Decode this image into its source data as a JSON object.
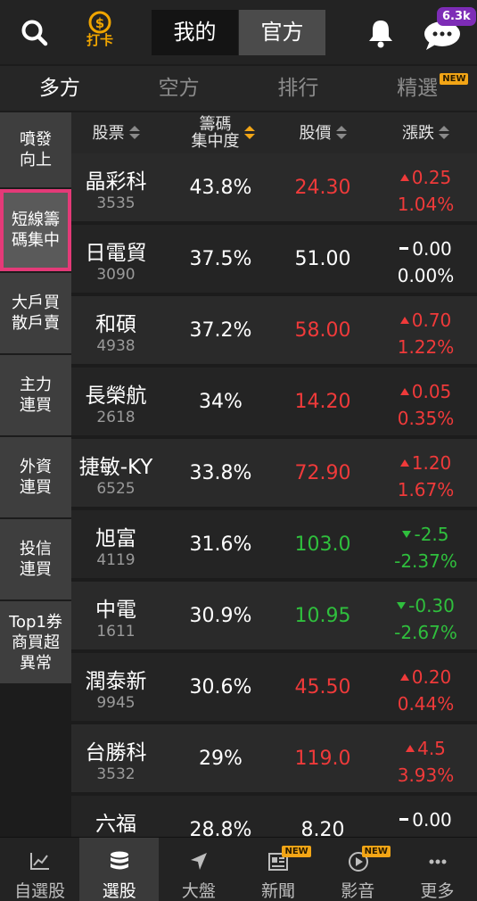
{
  "topbar": {
    "search_icon": "search-icon",
    "punch_label": "打卡",
    "segments": [
      "我的",
      "官方"
    ],
    "active_segment": "官方",
    "bell_icon": "bell-icon",
    "chat_icon": "chat-icon",
    "chat_badge": "6.3k"
  },
  "tabs": [
    {
      "label": "多方",
      "active": true
    },
    {
      "label": "空方"
    },
    {
      "label": "排行"
    },
    {
      "label": "精選",
      "badge": "NEW"
    }
  ],
  "sidebar": [
    {
      "label": "噴發\n向上"
    },
    {
      "label": "短線籌\n碼集中",
      "active": true
    },
    {
      "label": "大戶買\n散戶賣"
    },
    {
      "label": "主力\n連買"
    },
    {
      "label": "外資\n連買"
    },
    {
      "label": "投信\n連買"
    },
    {
      "label": "Top1券\n商買超\n異常"
    }
  ],
  "table": {
    "headers": {
      "stock": "股票",
      "concentration": "籌碼\n集中度",
      "price": "股價",
      "change": "漲跌"
    },
    "rows": [
      {
        "name": "晶彩科",
        "code": "3535",
        "concentration": "43.8%",
        "price": "24.30",
        "change": "0.25",
        "pct": "1.04%",
        "dir": "up"
      },
      {
        "name": "日電貿",
        "code": "3090",
        "concentration": "37.5%",
        "price": "51.00",
        "change": "0.00",
        "pct": "0.00%",
        "dir": "flat"
      },
      {
        "name": "和碩",
        "code": "4938",
        "concentration": "37.2%",
        "price": "58.00",
        "change": "0.70",
        "pct": "1.22%",
        "dir": "up"
      },
      {
        "name": "長榮航",
        "code": "2618",
        "concentration": "34%",
        "price": "14.20",
        "change": "0.05",
        "pct": "0.35%",
        "dir": "up"
      },
      {
        "name": "捷敏-KY",
        "code": "6525",
        "concentration": "33.8%",
        "price": "72.90",
        "change": "1.20",
        "pct": "1.67%",
        "dir": "up"
      },
      {
        "name": "旭富",
        "code": "4119",
        "concentration": "31.6%",
        "price": "103.0",
        "change": "-2.5",
        "pct": "-2.37%",
        "dir": "down"
      },
      {
        "name": "中電",
        "code": "1611",
        "concentration": "30.9%",
        "price": "10.95",
        "change": "-0.30",
        "pct": "-2.67%",
        "dir": "down"
      },
      {
        "name": "潤泰新",
        "code": "9945",
        "concentration": "30.6%",
        "price": "45.50",
        "change": "0.20",
        "pct": "0.44%",
        "dir": "up"
      },
      {
        "name": "台勝科",
        "code": "3532",
        "concentration": "29%",
        "price": "119.0",
        "change": "4.5",
        "pct": "3.93%",
        "dir": "up"
      },
      {
        "name": "六福",
        "code": "",
        "concentration": "28.8%",
        "price": "8.20",
        "change": "0.00",
        "pct": "",
        "dir": "flat"
      }
    ]
  },
  "bottomnav": [
    {
      "label": "自選股",
      "icon": "chart-line-icon"
    },
    {
      "label": "選股",
      "icon": "database-icon",
      "active": true
    },
    {
      "label": "大盤",
      "icon": "navigation-arrow-icon"
    },
    {
      "label": "新聞",
      "icon": "newspaper-icon",
      "badge": "NEW"
    },
    {
      "label": "影音",
      "icon": "play-circle-icon",
      "badge": "NEW"
    },
    {
      "label": "更多",
      "icon": "more-dots-icon"
    }
  ],
  "colors": {
    "up": "#ef3a3a",
    "down": "#2fbf3d",
    "flat": "#ffffff",
    "accent": "#f2a516",
    "highlight": "#e43a78",
    "badge": "#7d2cb6"
  }
}
